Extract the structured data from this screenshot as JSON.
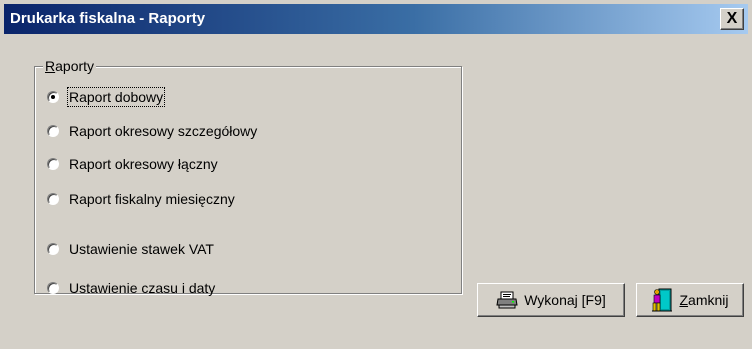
{
  "window": {
    "title": "Drukarka fiskalna - Raporty",
    "close_label": "X"
  },
  "group": {
    "label_first": "R",
    "label_rest": "aporty",
    "options": [
      {
        "label": "Raport dobowy",
        "selected": true
      },
      {
        "label": "Raport okresowy szczegółowy",
        "selected": false
      },
      {
        "label": "Raport okresowy łączny",
        "selected": false
      },
      {
        "label": "Raport fiskalny miesięczny",
        "selected": false
      },
      {
        "label": "Ustawienie stawek VAT",
        "selected": false
      },
      {
        "label": "Ustawienie czasu i daty",
        "selected": false
      }
    ]
  },
  "buttons": {
    "execute_label": "Wykonaj [F9]",
    "close_first": "Z",
    "close_rest": "amknij",
    "execute_icon": "printer-icon",
    "close_icon": "door-exit-icon"
  },
  "colors": {
    "face": "#d4d0c8",
    "titlebar_start": "#0a246a",
    "titlebar_end": "#a6caf0"
  }
}
